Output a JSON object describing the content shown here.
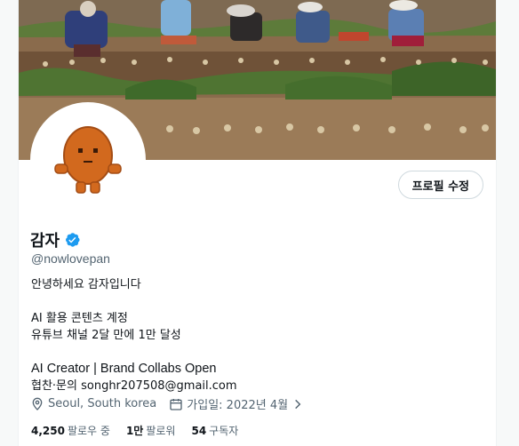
{
  "profile": {
    "name": "감자",
    "handle": "@nowlovepan",
    "edit_button_label": "프로필 수정",
    "verified": true,
    "bio": [
      "안녕하세요 감자입니다",
      "",
      "AI 활용 콘텐츠 계정",
      "유튜브 채널 2달 만에 1만 달성",
      "",
      "AI Creator | Brand Collabs Open",
      "협찬·문의 songhr207508@gmail.com"
    ],
    "location": "Seoul, South korea",
    "joined": "가입일: 2022년 4월",
    "stats": {
      "following_count": "4,250",
      "following_label": "팔로우 중",
      "followers_count": "1만",
      "followers_label": "팔로워",
      "subscriptions_count": "54",
      "subscriptions_label": "구독자"
    }
  },
  "colors": {
    "verified_blue": "#1d9bf0",
    "text_primary": "#0f1419",
    "text_secondary": "#536471",
    "avatar_potato": "#d2691e"
  },
  "icons": [
    "verified-badge-icon",
    "location-pin-icon",
    "calendar-icon",
    "chevron-right-icon"
  ]
}
